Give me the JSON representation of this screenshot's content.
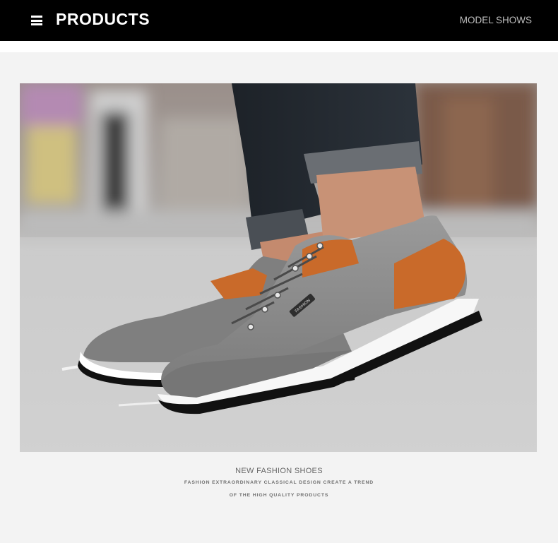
{
  "header": {
    "menu_icon": "hamburger-menu-icon",
    "title": "PRODUCTS",
    "right_label": "MODEL SHOWS"
  },
  "photo": {
    "subject": "product-photo",
    "shoe_logo_text": "FASHION"
  },
  "captions": {
    "headline": "NEW FASHION SHOES",
    "line1": "FASHION EXTRAORDINARY CLASSICAL DESIGN CREATE A TREND",
    "line2": "OF THE HIGH QUALITY PRODUCTS"
  },
  "colors": {
    "header_bg": "#000000",
    "shoe_gray": "#8a8a8a",
    "accent_orange": "#c96a2a"
  }
}
